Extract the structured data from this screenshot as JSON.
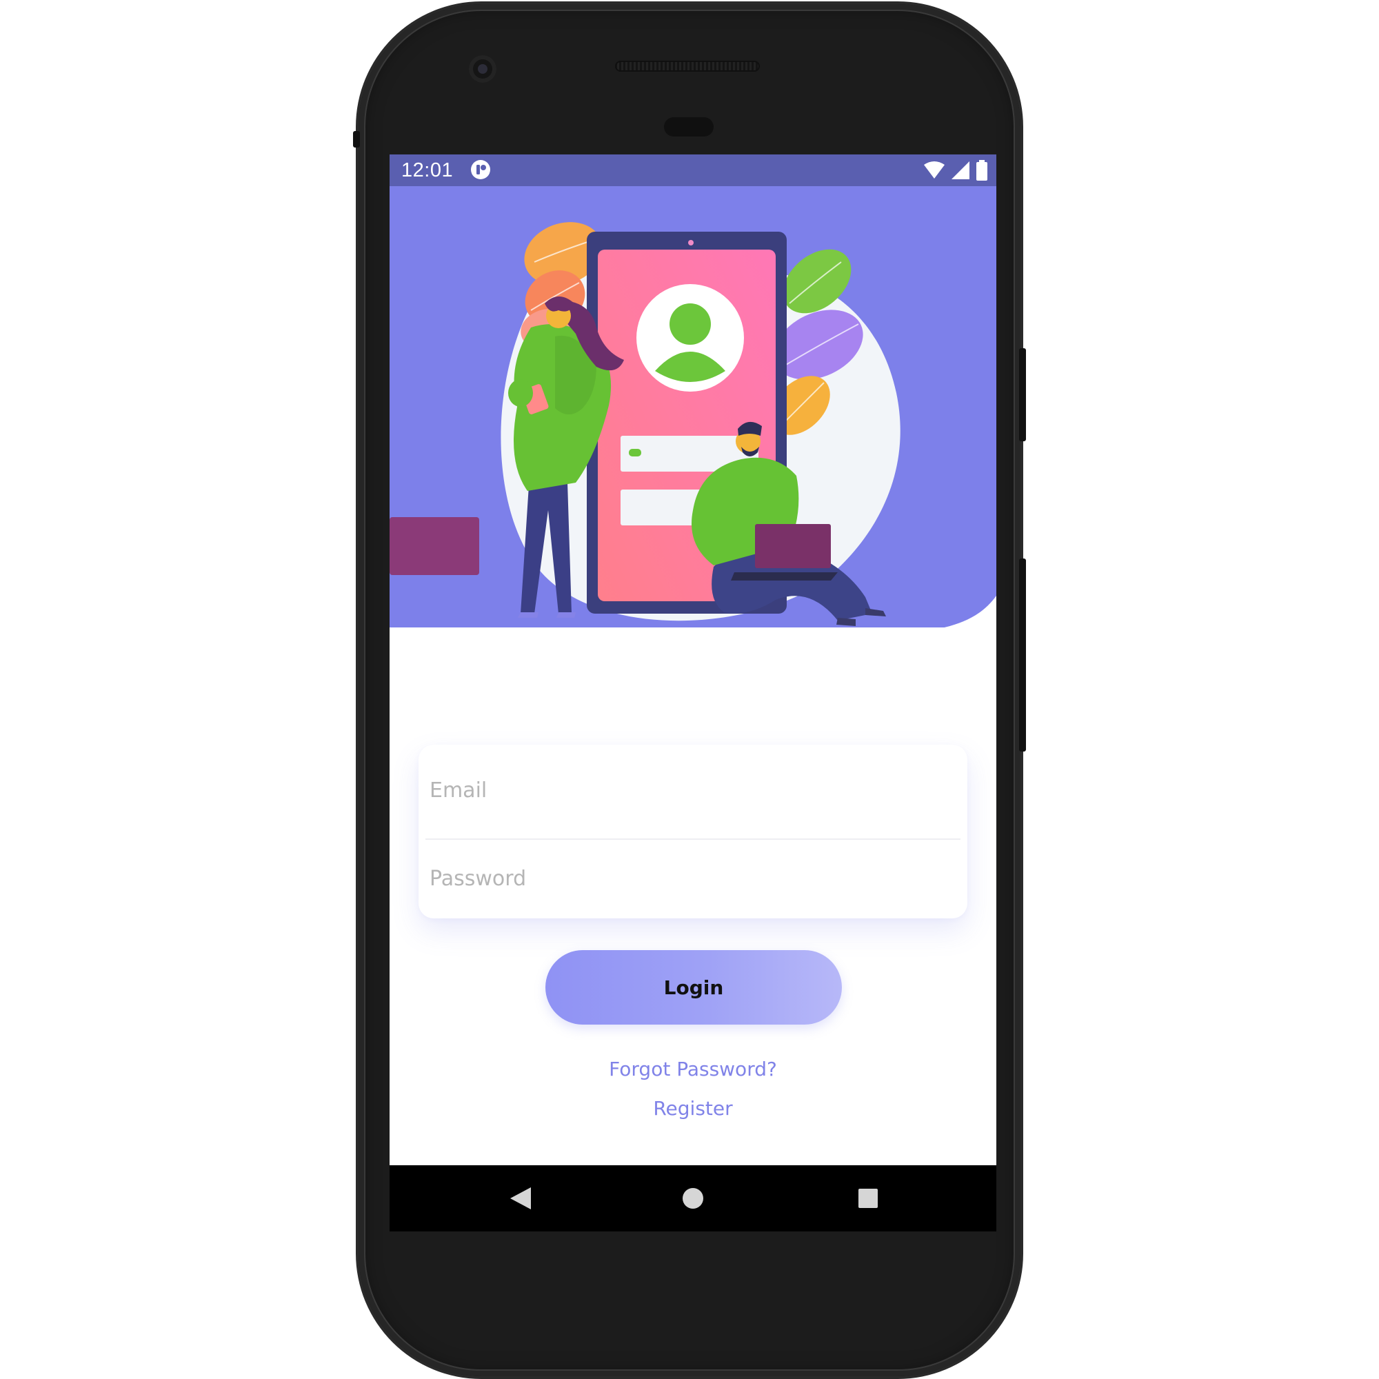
{
  "status_bar": {
    "time": "12:01",
    "app_icon": "chat-app-icon",
    "icons": [
      "wifi-icon",
      "cell-signal-icon",
      "battery-icon"
    ],
    "background": "#5a5fb0"
  },
  "hero": {
    "background": "#7d80ea",
    "illustration": "login-illustration"
  },
  "login_form": {
    "email_placeholder": "Email",
    "email_value": "",
    "password_placeholder": "Password",
    "password_value": ""
  },
  "actions": {
    "login_label": "Login",
    "forgot_password_label": "Forgot Password?",
    "register_label": "Register"
  },
  "nav_bar": {
    "back": "back-triangle-icon",
    "home": "home-circle-icon",
    "recents": "recents-square-icon"
  },
  "colors": {
    "accent": "#8083e8",
    "button_start": "#8f92f4",
    "button_end": "#b7b8f8"
  }
}
